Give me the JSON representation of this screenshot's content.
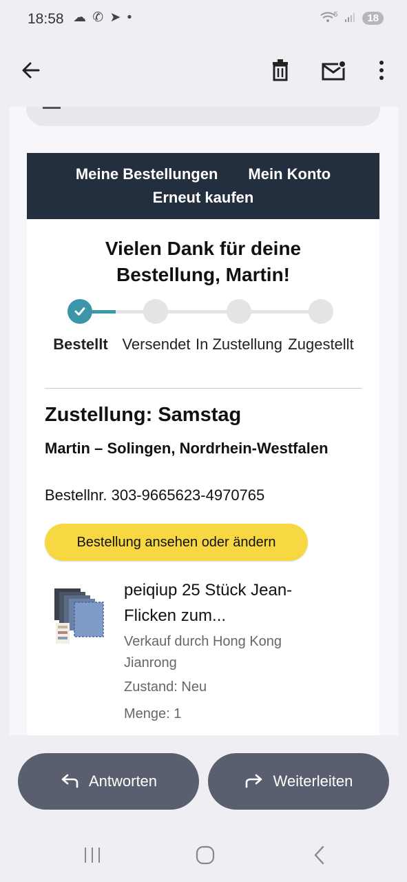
{
  "status": {
    "time": "18:58",
    "left_icons": "☁ ✆ ➤ •",
    "wifi_label": "5",
    "battery": "18"
  },
  "app_bar": {
    "back_icon": "arrow-left-icon",
    "delete_icon": "trash-icon",
    "mark_unread_icon": "mail-dot-icon",
    "more_icon": "more-vertical-icon"
  },
  "email": {
    "nav": {
      "my_orders": "Meine Bestellungen",
      "my_account": "Mein Konto",
      "buy_again": "Erneut kaufen"
    },
    "thanks_line1": "Vielen Dank für deine",
    "thanks_line2": "Bestellung, Martin!",
    "steps": [
      {
        "label": "Bestellt",
        "done": true
      },
      {
        "label": "Versendet",
        "done": false
      },
      {
        "label": "In Zustellung",
        "done": false
      },
      {
        "label": "Zugestellt",
        "done": false
      }
    ],
    "delivery_title": "Zustellung: Samstag",
    "recipient": "Martin – Solingen, Nordrhein-Westfalen",
    "order_number": "Bestellnr. 303-9665623-4970765",
    "cta_label": "Bestellung ansehen oder ändern",
    "product": {
      "title": "peiqiup 25 Stück Jean-Flicken zum...",
      "seller": "Verkauf durch Hong Kong Jianrong",
      "condition": "Zustand: Neu",
      "quantity": "Menge: 1"
    }
  },
  "actions": {
    "reply": "Antworten",
    "forward": "Weiterleiten"
  },
  "colors": {
    "nav_bg": "#232f3e",
    "progress_accent": "#3b96a9",
    "cta_bg": "#f7d843",
    "action_btn_bg": "#5a5f70"
  }
}
